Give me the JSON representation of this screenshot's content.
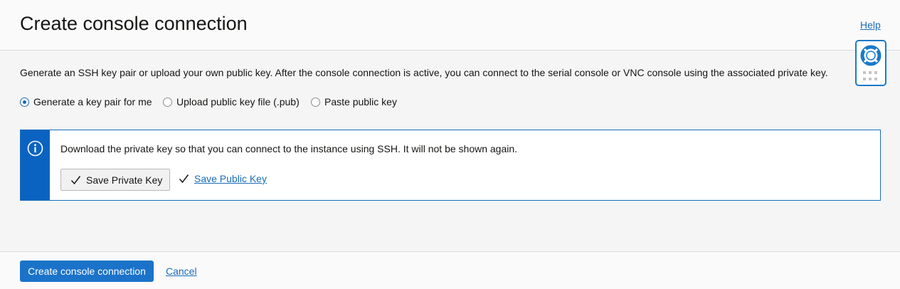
{
  "header": {
    "title": "Create console connection",
    "help_label": "Help",
    "help_widget_icon": "lifebuoy-icon"
  },
  "main": {
    "description": "Generate an SSH key pair or upload your own public key. After the console connection is active, you can connect to the serial console or VNC console using the associated private key.",
    "key_options": [
      {
        "label": "Generate a key pair for me",
        "selected": true
      },
      {
        "label": "Upload public key file (.pub)",
        "selected": false
      },
      {
        "label": "Paste public key",
        "selected": false
      }
    ],
    "info": {
      "icon": "info-icon",
      "text": "Download the private key so that you can connect to the instance using SSH. It will not be shown again.",
      "save_private_label": "Save Private Key",
      "save_public_label": "Save Public Key"
    }
  },
  "footer": {
    "create_label": "Create console connection",
    "cancel_label": "Cancel"
  },
  "colors": {
    "accent": "#1a6bb8",
    "info_bar": "#0b63c1",
    "primary_button": "#1a73c9"
  }
}
